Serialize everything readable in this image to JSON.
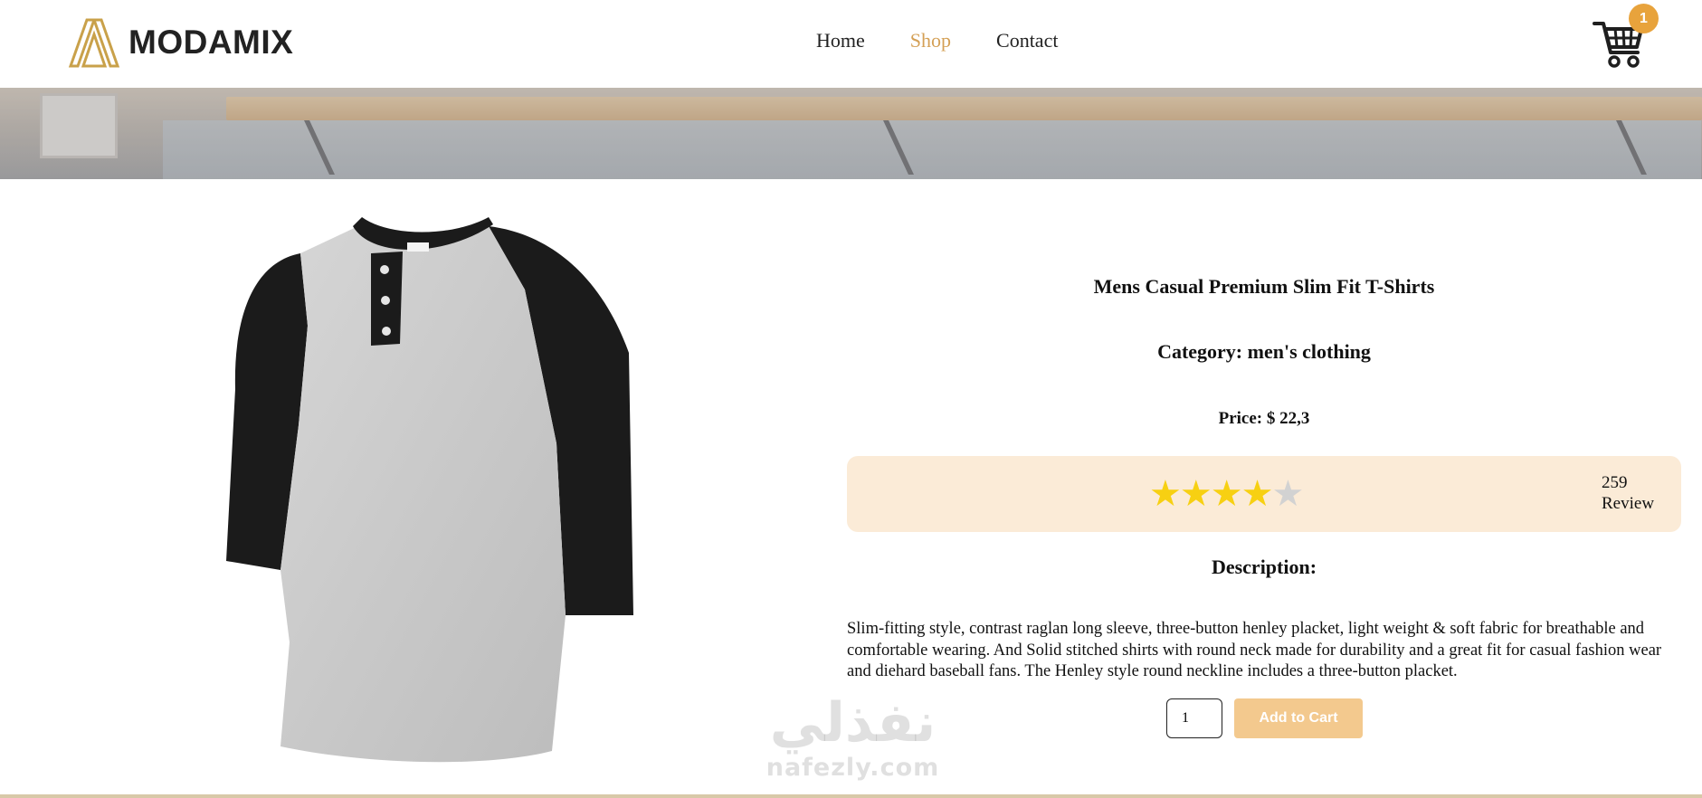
{
  "brand": {
    "name": "MODAMIX",
    "accent": "#d4a056"
  },
  "nav": {
    "items": [
      {
        "label": "Home",
        "active": false
      },
      {
        "label": "Shop",
        "active": true
      },
      {
        "label": "Contact",
        "active": false
      }
    ]
  },
  "cart": {
    "count": "1",
    "icon": "shopping-cart-icon"
  },
  "product": {
    "title": "Mens Casual Premium Slim Fit T-Shirts",
    "category": "Category: men's clothing",
    "price": "Price: $ 22,3",
    "rating": {
      "stars_filled": 4,
      "stars_total": 5,
      "star_glyph": "★",
      "review_count": "259",
      "review_label": "Review"
    },
    "description_title": "Description:",
    "description": "Slim-fitting style, contrast raglan long sleeve, three-button henley placket, light weight & soft fabric for breathable and comfortable wearing. And Solid stitched shirts with round neck made for durability and a great fit for casual fashion wear and diehard baseball fans. The Henley style round neckline includes a three-button placket.",
    "quantity": "1",
    "add_to_cart_label": "Add to Cart"
  },
  "watermark": {
    "arabic": "نفذلي",
    "latin": "nafezly.com"
  }
}
